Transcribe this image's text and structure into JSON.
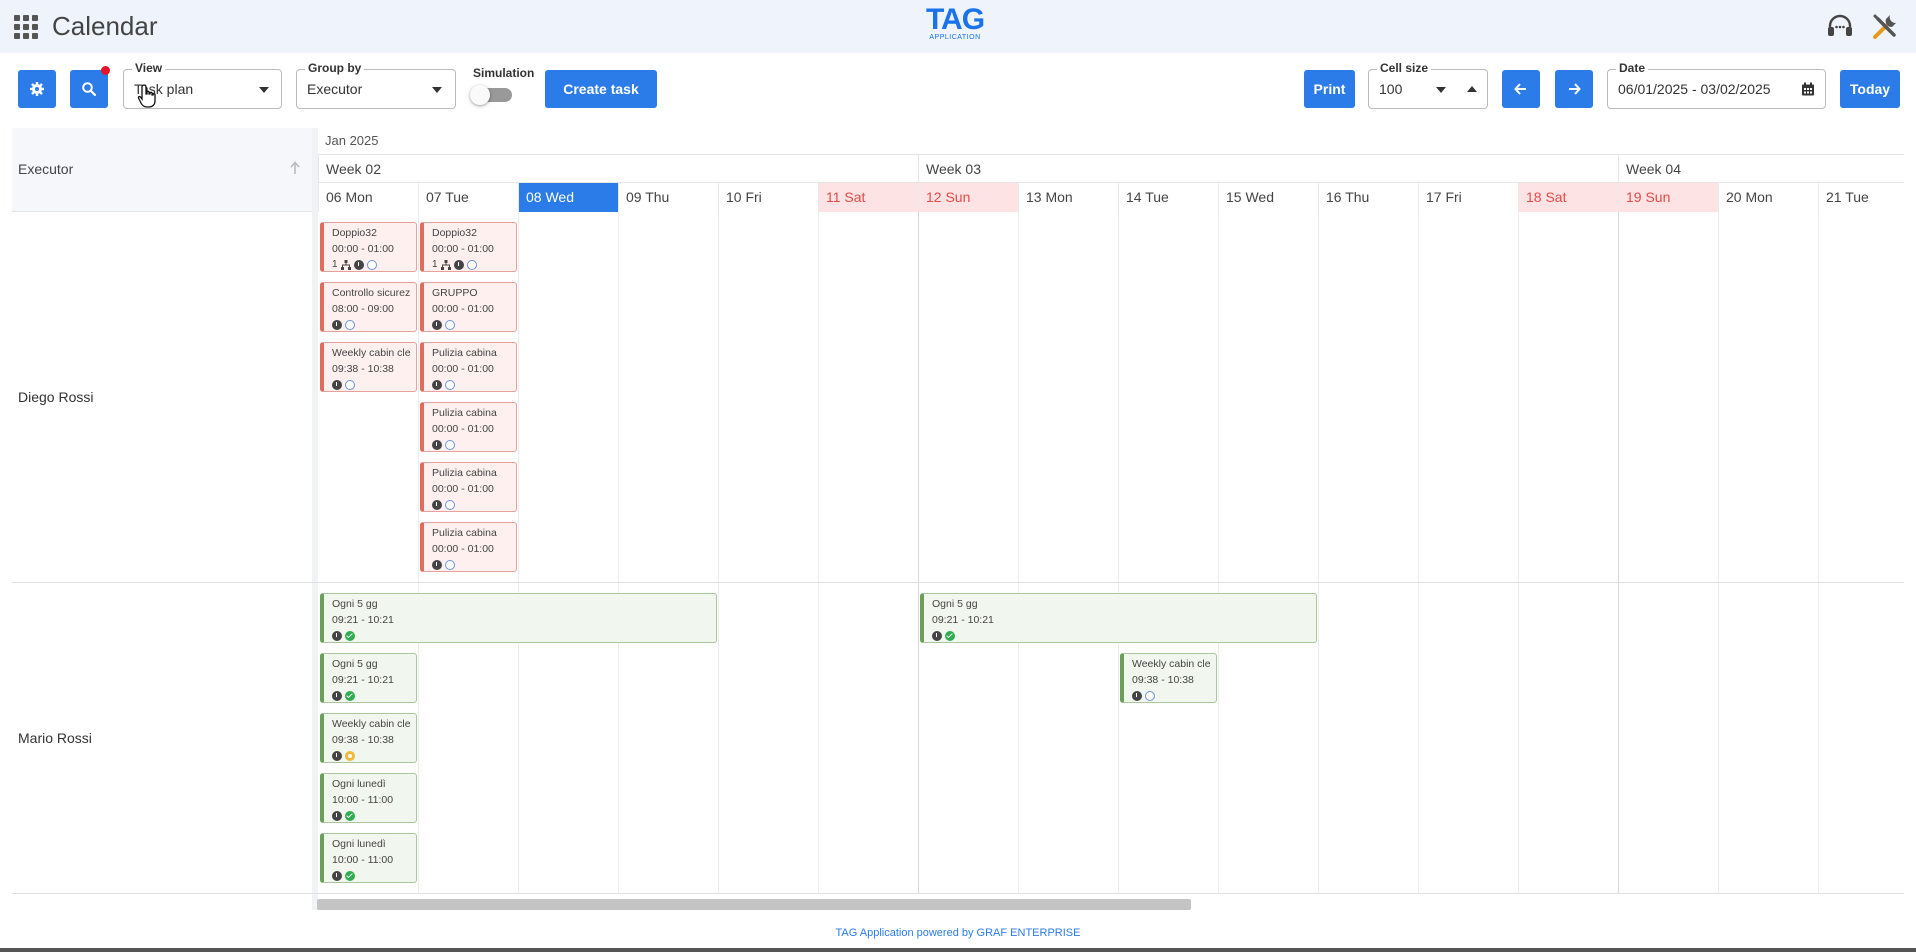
{
  "header": {
    "title": "Calendar",
    "logo_main": "TAG",
    "logo_sub": "APPLICATION",
    "apps_icon": "apps-grid-icon",
    "support_icon": "headset-icon",
    "tools_icon": "tools-icon"
  },
  "toolbar": {
    "settings_icon": "gear-icon",
    "search_icon": "search-icon",
    "view_label": "View",
    "view_value": "Task plan",
    "group_label": "Group by",
    "group_value": "Executor",
    "simulation_label": "Simulation",
    "simulation_on": false,
    "create_label": "Create task",
    "print_label": "Print",
    "cell_size_label": "Cell size",
    "cell_size_value": "100",
    "date_label": "Date",
    "date_value": "06/01/2025 - 03/02/2025",
    "today_label": "Today"
  },
  "grid": {
    "executor_header": "Executor",
    "month": "Jan 2025",
    "weeks": [
      "Week 02",
      "Week 03",
      "Week 04"
    ],
    "days": [
      {
        "label": "06 Mon",
        "kind": "normal"
      },
      {
        "label": "07 Tue",
        "kind": "normal"
      },
      {
        "label": "08 Wed",
        "kind": "today"
      },
      {
        "label": "09 Thu",
        "kind": "normal"
      },
      {
        "label": "10 Fri",
        "kind": "normal"
      },
      {
        "label": "11 Sat",
        "kind": "weekend"
      },
      {
        "label": "12 Sun",
        "kind": "weekend"
      },
      {
        "label": "13 Mon",
        "kind": "normal"
      },
      {
        "label": "14 Tue",
        "kind": "normal"
      },
      {
        "label": "15 Wed",
        "kind": "normal"
      },
      {
        "label": "16 Thu",
        "kind": "normal"
      },
      {
        "label": "17 Fri",
        "kind": "normal"
      },
      {
        "label": "18 Sat",
        "kind": "weekend"
      },
      {
        "label": "19 Sun",
        "kind": "weekend"
      },
      {
        "label": "20 Mon",
        "kind": "normal"
      },
      {
        "label": "21 Tue",
        "kind": "normal"
      }
    ],
    "executors": [
      "Diego Rossi",
      "Mario Rossi"
    ]
  },
  "tasks": {
    "diego": [
      {
        "title": "Doppio32",
        "time": "00:00 - 01:00",
        "count": "1",
        "icons": [
          "tree",
          "clock",
          "open"
        ]
      },
      {
        "title": "Doppio32",
        "time": "00:00 - 01:00",
        "count": "1",
        "icons": [
          "tree",
          "clock",
          "open"
        ]
      },
      {
        "title": "Controllo sicurez",
        "time": "08:00 - 09:00",
        "icons": [
          "clock",
          "open"
        ]
      },
      {
        "title": "GRUPPO",
        "time": "00:00 - 01:00",
        "icons": [
          "clock",
          "open"
        ]
      },
      {
        "title": "Weekly cabin cle",
        "time": "09:38 - 10:38",
        "icons": [
          "clock",
          "open"
        ]
      },
      {
        "title": "Pulizia cabina",
        "time": "00:00 - 01:00",
        "icons": [
          "clock",
          "open"
        ]
      },
      {
        "title": "Pulizia cabina",
        "time": "00:00 - 01:00",
        "icons": [
          "clock",
          "open"
        ]
      },
      {
        "title": "Pulizia cabina",
        "time": "00:00 - 01:00",
        "icons": [
          "clock",
          "open"
        ]
      },
      {
        "title": "Pulizia cabina",
        "time": "00:00 - 01:00",
        "icons": [
          "clock",
          "open"
        ]
      }
    ],
    "mario": [
      {
        "title": "Ogni 5 gg",
        "time": "09:21 - 10:21",
        "icons": [
          "clock",
          "done"
        ]
      },
      {
        "title": "Ogni 5 gg",
        "time": "09:21 - 10:21",
        "icons": [
          "clock",
          "done"
        ]
      },
      {
        "title": "Ogni 5 gg",
        "time": "09:21 - 10:21",
        "icons": [
          "clock",
          "done"
        ]
      },
      {
        "title": "Weekly cabin cle",
        "time": "09:38 - 10:38",
        "icons": [
          "clock",
          "open"
        ]
      },
      {
        "title": "Weekly cabin cle",
        "time": "09:38 - 10:38",
        "icons": [
          "clock",
          "warn"
        ]
      },
      {
        "title": "Ogni lunedì",
        "time": "10:00 - 11:00",
        "icons": [
          "clock",
          "done"
        ]
      },
      {
        "title": "Ogni lunedì",
        "time": "10:00 - 11:00",
        "icons": [
          "clock",
          "done"
        ]
      }
    ]
  },
  "footer": {
    "text": "TAG Application powered by GRAF ENTERPRISE"
  }
}
